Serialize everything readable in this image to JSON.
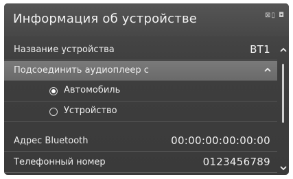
{
  "header": {
    "title": "Информация об устройстве",
    "status_icons": "⊠▯ ◘"
  },
  "rows": {
    "device_name": {
      "label": "Название устройства",
      "value": "BT1"
    },
    "connect_audio": {
      "label": "Подсоединить аудиоплеер с"
    },
    "options": [
      {
        "label": "Автомобиль",
        "selected": true
      },
      {
        "label": "Устройство",
        "selected": false
      }
    ],
    "bt_address": {
      "label": "Адрес Bluetooth",
      "value": "00:00:00:00:00:00"
    },
    "phone_number": {
      "label": "Телефонный номер",
      "value": "0123456789"
    }
  },
  "icons": {
    "scroll_up": "chevron-up-icon",
    "scroll_down": "chevron-down-icon",
    "collapse": "chevron-up-icon"
  }
}
